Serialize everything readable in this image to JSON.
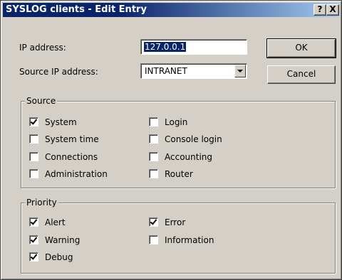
{
  "window": {
    "title": "SYSLOG clients - Edit Entry",
    "help_label": "?",
    "close_label": "X"
  },
  "form": {
    "ip_label": "IP address:",
    "ip_value": "127.0.0.1",
    "source_ip_label": "Source IP address:",
    "source_ip_value": "INTRANET"
  },
  "buttons": {
    "ok": "OK",
    "cancel": "Cancel"
  },
  "source": {
    "title": "Source",
    "items": [
      {
        "label": "System",
        "checked": true
      },
      {
        "label": "System time",
        "checked": false
      },
      {
        "label": "Connections",
        "checked": false
      },
      {
        "label": "Administration",
        "checked": false
      },
      {
        "label": "Login",
        "checked": false
      },
      {
        "label": "Console login",
        "checked": false
      },
      {
        "label": "Accounting",
        "checked": false
      },
      {
        "label": "Router",
        "checked": false
      }
    ]
  },
  "priority": {
    "title": "Priority",
    "items": [
      {
        "label": "Alert",
        "checked": true
      },
      {
        "label": "Warning",
        "checked": true
      },
      {
        "label": "Debug",
        "checked": true
      },
      {
        "label": "Error",
        "checked": true
      },
      {
        "label": "Information",
        "checked": false
      }
    ]
  }
}
